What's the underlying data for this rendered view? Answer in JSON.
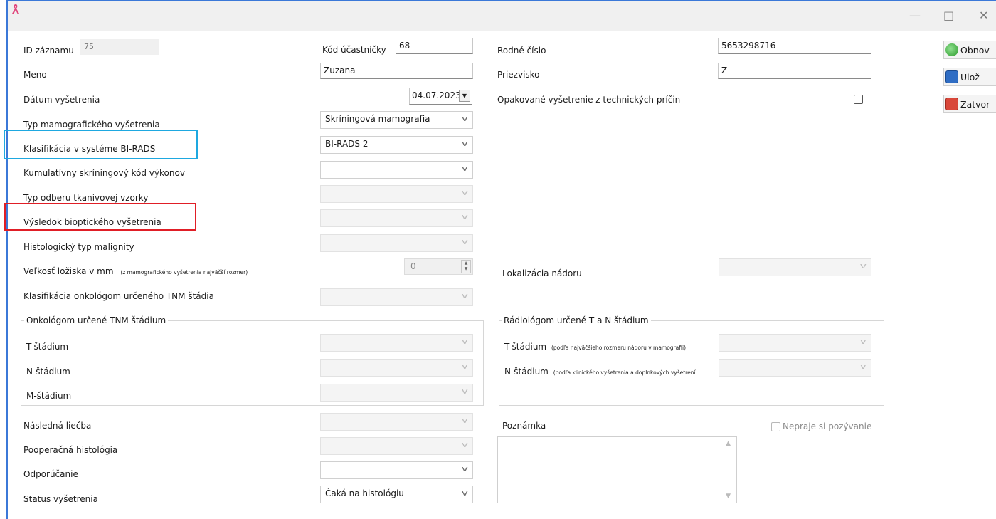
{
  "window": {
    "app_icon": "pink-ribbon-icon",
    "minimize": "—",
    "maximize": "□",
    "close": "✕"
  },
  "toolbar": {
    "refresh_label": "Obnov",
    "save_label": "Ulož",
    "close_label": "Zatvor"
  },
  "form": {
    "record_id": {
      "label": "ID záznamu",
      "value": "75"
    },
    "participant_code": {
      "label": "Kód účastníčky",
      "value": "68"
    },
    "birth_number": {
      "label": "Rodné číslo",
      "value": "5653298716"
    },
    "first_name": {
      "label": "Meno",
      "value": "Zuzana"
    },
    "surname": {
      "label": "Priezvisko",
      "value": "Z"
    },
    "exam_date": {
      "label": "Dátum vyšetrenia",
      "value": "04.07.2023"
    },
    "repeat_exam": {
      "label": "Opakované vyšetrenie z technických príčin",
      "checked": false
    },
    "mammo_type": {
      "label": "Typ mamografického vyšetrenia",
      "value": "Skríningová mamografia"
    },
    "birads": {
      "label": "Klasifikácia v systéme BI-RADS",
      "value": "BI-RADS 2"
    },
    "cumulative_code": {
      "label": "Kumulatívny skríningový kód výkonov",
      "value": ""
    },
    "tissue_sample_type": {
      "label": "Typ odberu tkanivovej vzorky",
      "value": ""
    },
    "biopsy_result": {
      "label": "Výsledok bioptického vyšetrenia",
      "value": ""
    },
    "histologic_type": {
      "label": "Histologický typ malignity",
      "value": ""
    },
    "lesion_size": {
      "label": "Veľkosť ložiska v mm",
      "note": "(z mamografického vyšetrenia najväčší rozmer)",
      "value": "0"
    },
    "tumor_localization": {
      "label": "Lokalizácia nádoru",
      "value": ""
    },
    "tnm_classification": {
      "label": "Klasifikácia onkológom určeného TNM štádia",
      "value": ""
    },
    "onco_group": {
      "title": "Onkológom určené TNM štádium",
      "t_label": "T-štádium",
      "n_label": "N-štádium",
      "m_label": "M-štádium"
    },
    "radio_group": {
      "title": "Rádiológom určené T a N štádium",
      "t_label": "T-štádium",
      "t_note": "(podľa najväčšieho rozmeru nádoru v mamografii)",
      "n_label": "N-štádium",
      "n_note": "(podľa klinického vyšetrenia a doplnkových vyšetrení"
    },
    "follow_treatment": {
      "label": "Následná liečba",
      "value": ""
    },
    "postop_histology": {
      "label": "Pooperačná histológia",
      "value": ""
    },
    "recommendation": {
      "label": "Odporúčanie",
      "value": ""
    },
    "exam_status": {
      "label": "Status vyšetrenia",
      "value": "Čaká na histológiu"
    },
    "note": {
      "label": "Poznámka",
      "value": ""
    },
    "no_invitation": {
      "label": "Nepraje si pozývanie",
      "checked": false
    }
  },
  "colors": {
    "highlight_blue": "#1ea8e0",
    "highlight_red": "#e01e26",
    "window_border": "#3b78d8"
  }
}
